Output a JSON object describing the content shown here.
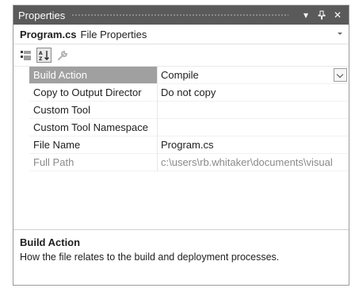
{
  "titlebar": {
    "title": "Properties",
    "pin_glyph": "⊥",
    "close_glyph": "✕",
    "dropdown_glyph": "▾"
  },
  "object_selector": {
    "name": "Program.cs",
    "type": "File Properties"
  },
  "toolbar": {
    "buttons": [
      {
        "icon": "categorized-icon",
        "active": false
      },
      {
        "icon": "alphabetical-icon",
        "active": true
      },
      {
        "icon": "wrench-icon",
        "active": false
      }
    ]
  },
  "properties": [
    {
      "name": "Build Action",
      "value": "Compile"
    },
    {
      "name": "Copy to Output Director",
      "value": "Do not copy"
    },
    {
      "name": "Custom Tool",
      "value": ""
    },
    {
      "name": "Custom Tool Namespace",
      "value": ""
    },
    {
      "name": "File Name",
      "value": "Program.cs"
    },
    {
      "name": "Full Path",
      "value": "c:\\users\\rb.whitaker\\documents\\visual"
    }
  ],
  "description": {
    "title": "Build Action",
    "text": "How the file relates to the build and deployment processes."
  },
  "colors": {
    "titlebar": "#5a5a5a",
    "selected_row": "#a0a0a0"
  }
}
